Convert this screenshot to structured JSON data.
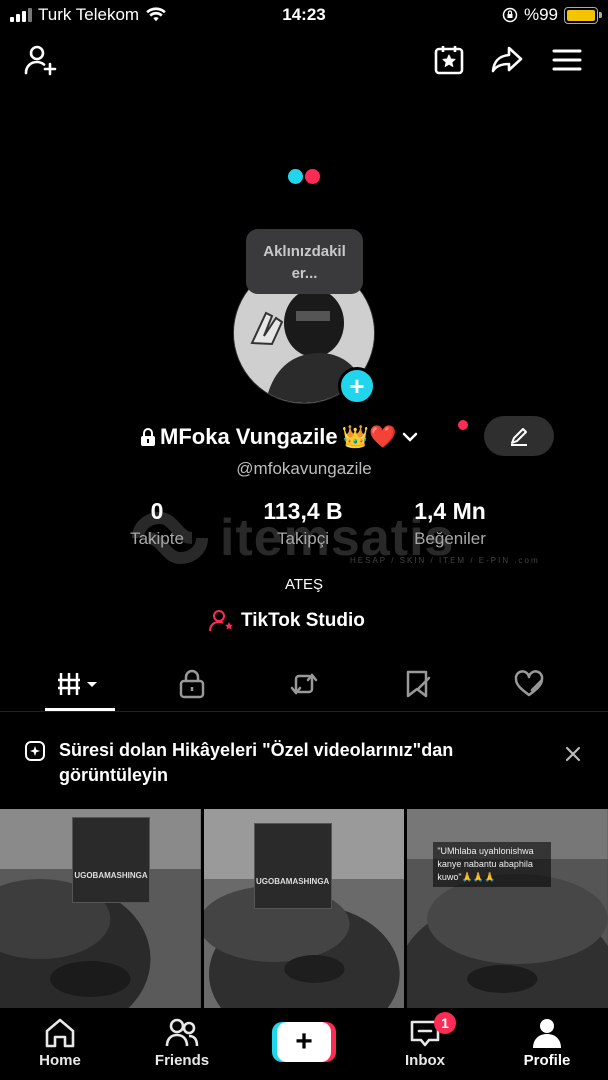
{
  "status_bar": {
    "carrier": "Turk Telekom",
    "time": "14:23",
    "battery": "%99"
  },
  "topbar": {
    "icons": [
      "add-friend-icon",
      "calendar-star-icon",
      "share-icon",
      "menu-icon"
    ]
  },
  "profile": {
    "note_bubble": "Aklınızdakil er...",
    "display_name": "MFoka Vungazile",
    "name_emojis": "👑❤️",
    "username": "@mfokavungazile",
    "bio": "ATEŞ"
  },
  "stats": [
    {
      "value": "0",
      "label": "Takipte"
    },
    {
      "value": "113,4 B",
      "label": "Takipçi"
    },
    {
      "value": "1,4 Mn",
      "label": "Beğeniler"
    }
  ],
  "watermark": {
    "text": "itemsatis",
    "sub": "HESAP / SKIN / ITEM / E-PIN .com"
  },
  "studio": {
    "label": "TikTok Studio"
  },
  "tabs": [
    "videos-grid-icon",
    "private-lock-icon",
    "repost-icon",
    "favorites-icon",
    "liked-icon"
  ],
  "banner": {
    "text": "Süresi dolan Hikâyeleri \"Özel videolarınız\"dan görüntüleyin"
  },
  "grid": {
    "videos": [
      {
        "poster_title": "UGOBAMASHINGA"
      },
      {
        "poster_title": "UGOBAMASHINGA"
      },
      {
        "caption": "\"UMhlaba uyahlonishwa kanye nabantu abaphila kuwo\"🙏🙏🙏"
      }
    ]
  },
  "bottom_nav": {
    "items": [
      {
        "label": "Home"
      },
      {
        "label": "Friends"
      },
      {
        "label": "Inbox"
      },
      {
        "label": "Profile"
      }
    ],
    "inbox_badge": "1"
  },
  "colors": {
    "accent_cyan": "#20d5ec",
    "accent_red": "#fe2c55",
    "battery": "#f5c400"
  }
}
